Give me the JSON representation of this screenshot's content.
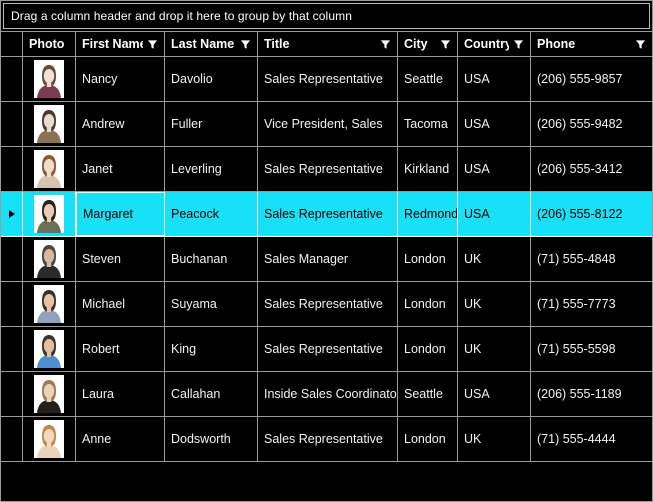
{
  "colors": {
    "background": "#000000",
    "gridline": "#9a9a9a",
    "text": "#f2f2f2",
    "selection": "#17E0F7",
    "selection_text": "#000000",
    "current_cell_border": "#ffffff"
  },
  "group_panel": {
    "text": "Drag a column header and drop it here to group by that column"
  },
  "columns": [
    {
      "key": "indicator",
      "label": "",
      "filter": false,
      "class": "c-ind"
    },
    {
      "key": "photo",
      "label": "Photo",
      "filter": false,
      "class": "c-photo"
    },
    {
      "key": "first",
      "label": "First Name",
      "filter": true,
      "class": "c-first"
    },
    {
      "key": "last",
      "label": "Last Name",
      "filter": true,
      "class": "c-last"
    },
    {
      "key": "title",
      "label": "Title",
      "filter": true,
      "class": "c-title"
    },
    {
      "key": "city",
      "label": "City",
      "filter": true,
      "class": "c-city"
    },
    {
      "key": "country",
      "label": "Country",
      "filter": true,
      "class": "c-cntry"
    },
    {
      "key": "phone",
      "label": "Phone",
      "filter": true,
      "class": "c-phone"
    }
  ],
  "icons": {
    "filter": "filter-funnel-icon",
    "row_indicator": "row-indicator-arrow-icon",
    "photo": "employee-photo-icon"
  },
  "rows": [
    {
      "first": "Nancy",
      "last": "Davolio",
      "title": "Sales Representative",
      "city": "Seattle",
      "country": "USA",
      "phone": "(206) 555-9857",
      "selected": false,
      "current_cell": null,
      "photo_colors": [
        "#f0e0d8",
        "#6b4a3a",
        "#7d3b52"
      ]
    },
    {
      "first": "Andrew",
      "last": "Fuller",
      "title": "Vice President, Sales",
      "city": "Tacoma",
      "country": "USA",
      "phone": "(206) 555-9482",
      "selected": false,
      "current_cell": null,
      "photo_colors": [
        "#e8dcd0",
        "#4a3b2a",
        "#8a7254"
      ]
    },
    {
      "first": "Janet",
      "last": "Leverling",
      "title": "Sales Representative",
      "city": "Kirkland",
      "country": "USA",
      "phone": "(206) 555-3412",
      "selected": false,
      "current_cell": null,
      "photo_colors": [
        "#f3ddc8",
        "#8a5a34",
        "#d8c4ae"
      ]
    },
    {
      "first": "Margaret",
      "last": "Peacock",
      "title": "Sales Representative",
      "city": "Redmond",
      "country": "USA",
      "phone": "(206) 555-8122",
      "selected": true,
      "current_cell": "first",
      "photo_colors": [
        "#e7cdb8",
        "#2c2018",
        "#6d7055"
      ]
    },
    {
      "first": "Steven",
      "last": "Buchanan",
      "title": "Sales Manager",
      "city": "London",
      "country": "UK",
      "phone": "(71) 555-4848",
      "selected": false,
      "current_cell": null,
      "photo_colors": [
        "#d8b9a0",
        "#474747",
        "#2b2b2b"
      ]
    },
    {
      "first": "Michael",
      "last": "Suyama",
      "title": "Sales Representative",
      "city": "London",
      "country": "UK",
      "phone": "(71) 555-7773",
      "selected": false,
      "current_cell": null,
      "photo_colors": [
        "#e8c4a6",
        "#3a3126",
        "#8fa4bc"
      ]
    },
    {
      "first": "Robert",
      "last": "King",
      "title": "Sales Representative",
      "city": "London",
      "country": "UK",
      "phone": "(71) 555-5598",
      "selected": false,
      "current_cell": null,
      "photo_colors": [
        "#e3bfa0",
        "#3b3428",
        "#4f8fd0"
      ]
    },
    {
      "first": "Laura",
      "last": "Callahan",
      "title": "Inside Sales Coordinator",
      "city": "Seattle",
      "country": "USA",
      "phone": "(206) 555-1189",
      "selected": false,
      "current_cell": null,
      "photo_colors": [
        "#edd2bb",
        "#9a7c52",
        "#23201e"
      ]
    },
    {
      "first": "Anne",
      "last": "Dodsworth",
      "title": "Sales Representative",
      "city": "London",
      "country": "UK",
      "phone": "(71) 555-4444",
      "selected": false,
      "current_cell": null,
      "photo_colors": [
        "#f2d8bf",
        "#c08a4a",
        "#e9d3ba"
      ]
    }
  ]
}
